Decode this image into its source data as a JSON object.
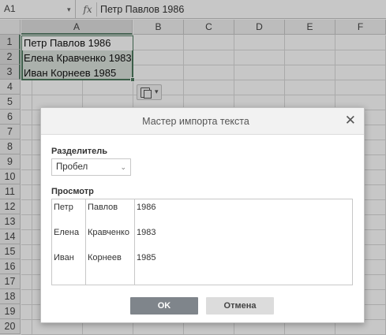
{
  "formula_bar": {
    "cell_ref": "A1",
    "fx": "fx",
    "formula": "Петр Павлов 1986"
  },
  "columns": [
    "A",
    "B",
    "C",
    "D",
    "E",
    "F"
  ],
  "rows": [
    "1",
    "2",
    "3",
    "4",
    "5",
    "6",
    "7",
    "8",
    "9",
    "10",
    "11",
    "12",
    "13",
    "14",
    "15",
    "16",
    "17",
    "18",
    "19",
    "20"
  ],
  "cells": [
    "Петр Павлов 1986",
    "Елена Кравченко 1983",
    "Иван Корнеев 1985"
  ],
  "dialog": {
    "title": "Мастер импорта текста",
    "delimiter_label": "Разделитель",
    "delimiter_value": "Пробел",
    "preview_label": "Просмотр",
    "preview_rows": [
      [
        "Петр",
        "Павлов",
        "1986"
      ],
      [
        "Елена",
        "Кравченко",
        "1983"
      ],
      [
        "Иван",
        "Корнеев",
        "1985"
      ]
    ],
    "ok_label": "OK",
    "cancel_label": "Отмена"
  },
  "colors": {
    "selection_border": "#4f7a5f",
    "ok_button": "#7f858b",
    "cancel_button": "#dcdcdc"
  },
  "icons": [
    "chevron-down-icon",
    "fx-icon",
    "paste-options-icon",
    "close-icon"
  ]
}
